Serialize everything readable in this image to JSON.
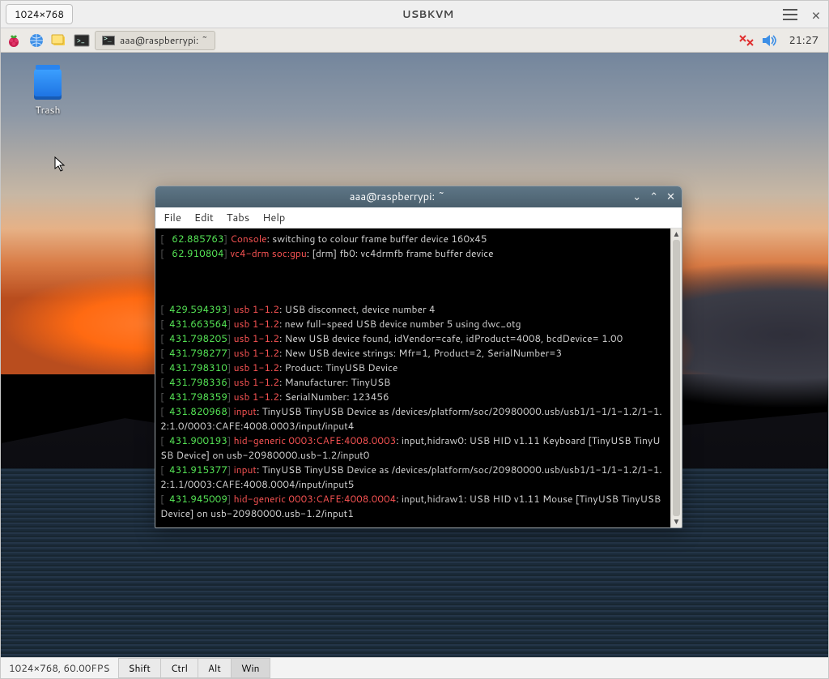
{
  "outer": {
    "resolution_btn": "1024×768",
    "title": "USBKVM",
    "hamburger": "menu",
    "close": "×"
  },
  "remote": {
    "taskbar": {
      "task_button_label": "aaa@raspberrypi: ~",
      "clock": "21:27"
    },
    "desktop": {
      "trash_label": "Trash"
    },
    "terminal": {
      "title": "aaa@raspberrypi: ~",
      "controls": {
        "min": "⌄",
        "max": "⌃",
        "close": "✕"
      },
      "menu": {
        "file": "File",
        "edit": "Edit",
        "tabs": "Tabs",
        "help": "Help"
      },
      "lines": [
        {
          "b": "[",
          "t": "   62.885763",
          "e": "] ",
          "tag": "Console",
          "msg": ": switching to colour frame buffer device 160x45"
        },
        {
          "b": "[",
          "t": "   62.910804",
          "e": "] ",
          "tag": "vc4-drm soc:gpu",
          "msg": ": [drm] fb0: vc4drmfb frame buffer device"
        },
        {
          "blank": true
        },
        {
          "blank": true
        },
        {
          "blank": true
        },
        {
          "b": "[",
          "t": "  429.594393",
          "e": "] ",
          "tag": "usb 1-1.2",
          "msg": ": USB disconnect, device number 4"
        },
        {
          "b": "[",
          "t": "  431.663564",
          "e": "] ",
          "tag": "usb 1-1.2",
          "msg": ": new full-speed USB device number 5 using dwc_otg"
        },
        {
          "b": "[",
          "t": "  431.798205",
          "e": "] ",
          "tag": "usb 1-1.2",
          "msg": ": New USB device found, idVendor=cafe, idProduct=4008, bcdDevice= 1.00"
        },
        {
          "b": "[",
          "t": "  431.798277",
          "e": "] ",
          "tag": "usb 1-1.2",
          "msg": ": New USB device strings: Mfr=1, Product=2, SerialNumber=3"
        },
        {
          "b": "[",
          "t": "  431.798310",
          "e": "] ",
          "tag": "usb 1-1.2",
          "msg": ": Product: TinyUSB Device"
        },
        {
          "b": "[",
          "t": "  431.798336",
          "e": "] ",
          "tag": "usb 1-1.2",
          "msg": ": Manufacturer: TinyUSB"
        },
        {
          "b": "[",
          "t": "  431.798359",
          "e": "] ",
          "tag": "usb 1-1.2",
          "msg": ": SerialNumber: 123456"
        },
        {
          "b": "[",
          "t": "  431.820968",
          "e": "] ",
          "tag": "input",
          "msg": ": TinyUSB TinyUSB Device as /devices/platform/soc/20980000.usb/usb1/1-1/1-1.2/1-1.2:1.0/0003:CAFE:4008.0003/input/input4"
        },
        {
          "b": "[",
          "t": "  431.900193",
          "e": "] ",
          "tag": "hid-generic 0003:CAFE:4008.0003",
          "msg": ": input,hidraw0: USB HID v1.11 Keyboard [TinyUSB TinyUSB Device] on usb-20980000.usb-1.2/input0"
        },
        {
          "b": "[",
          "t": "  431.915377",
          "e": "] ",
          "tag": "input",
          "msg": ": TinyUSB TinyUSB Device as /devices/platform/soc/20980000.usb/usb1/1-1/1-1.2/1-1.2:1.1/0003:CAFE:4008.0004/input/input5"
        },
        {
          "b": "[",
          "t": "  431.945009",
          "e": "] ",
          "tag": "hid-generic 0003:CAFE:4008.0004",
          "msg": ": input,hidraw1: USB HID v1.11 Mouse [TinyUSB TinyUSB Device] on usb-20980000.usb-1.2/input1"
        }
      ]
    }
  },
  "statusbar": {
    "info": "1024×768, 60.00FPS",
    "mods": {
      "shift": "Shift",
      "ctrl": "Ctrl",
      "alt": "Alt",
      "win": "Win"
    }
  }
}
